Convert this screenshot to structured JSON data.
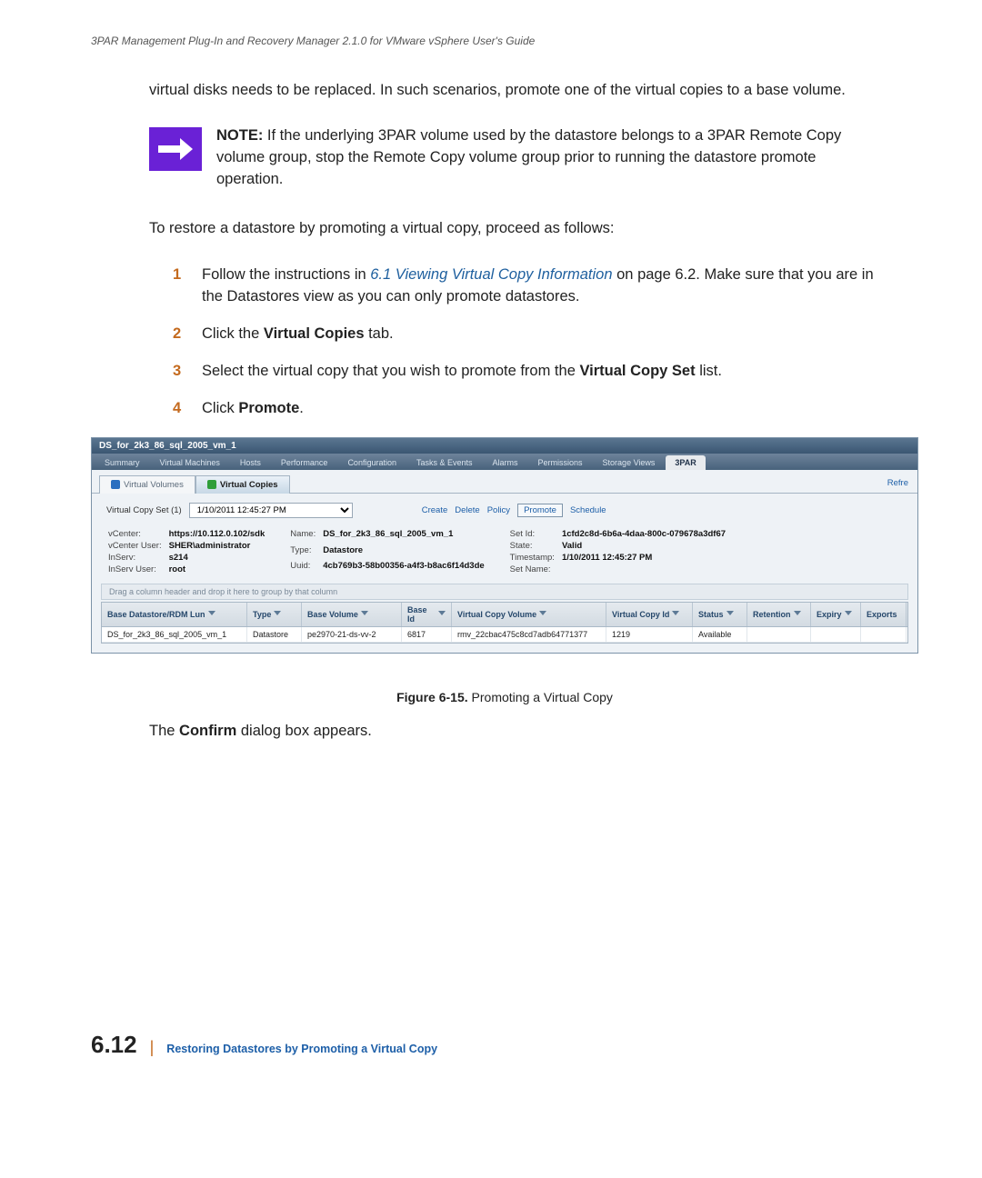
{
  "doc": {
    "header": "3PAR Management Plug-In and Recovery Manager 2.1.0 for VMware vSphere User's Guide",
    "intro": "virtual disks needs to be replaced. In such scenarios, promote one of the virtual copies to a base volume.",
    "note_label": "NOTE:",
    "note_body": " If the underlying 3PAR volume used by the datastore belongs to a 3PAR Remote Copy volume group, stop the Remote Copy volume group prior to running the datastore promote operation.",
    "lead": "To restore a datastore by promoting a virtual copy, proceed as follows:",
    "steps": {
      "s1a": "Follow the instructions in ",
      "s1link": "6.1 Viewing Virtual Copy Information",
      "s1b": " on page 6.2. Make sure that you are in the Datastores view as you can only promote datastores.",
      "s2a": "Click the ",
      "s2b": "Virtual Copies",
      "s2c": " tab.",
      "s3a": "Select the virtual copy that you wish to promote from the ",
      "s3b": "Virtual Copy Set",
      "s3c": " list.",
      "s4a": "Click ",
      "s4b": "Promote",
      "s4c": "."
    },
    "figure_label": "Figure 6-15.",
    "figure_title": "  Promoting a Virtual Copy",
    "after_a": "The ",
    "after_b": "Confirm",
    "after_c": " dialog box appears.",
    "page_num": "6.12",
    "footer_title": "Restoring Datastores by Promoting a Virtual Copy"
  },
  "app": {
    "title": "DS_for_2k3_86_sql_2005_vm_1",
    "tabs": [
      "Summary",
      "Virtual Machines",
      "Hosts",
      "Performance",
      "Configuration",
      "Tasks & Events",
      "Alarms",
      "Permissions",
      "Storage Views",
      "3PAR"
    ],
    "sub_tabs": {
      "vv": "Virtual Volumes",
      "vc": "Virtual Copies"
    },
    "refresh": "Refre",
    "vcs_label": "Virtual Copy Set (1)",
    "vcs_value": "1/10/2011 12:45:27 PM",
    "actions": {
      "create": "Create",
      "delete": "Delete",
      "policy": "Policy",
      "promote": "Promote",
      "schedule": "Schedule"
    },
    "info": {
      "vcenter_l": "vCenter:",
      "vcenter_v": "https://10.112.0.102/sdk",
      "vuser_l": "vCenter User:",
      "vuser_v": "SHER\\administrator",
      "inserv_l": "InServ:",
      "inserv_v": "s214",
      "iuser_l": "InServ User:",
      "iuser_v": "root",
      "name_l": "Name:",
      "name_v": "DS_for_2k3_86_sql_2005_vm_1",
      "type_l": "Type:",
      "type_v": "Datastore",
      "uuid_l": "Uuid:",
      "uuid_v": "4cb769b3-58b00356-a4f3-b8ac6f14d3de",
      "setid_l": "Set Id:",
      "setid_v": "1cfd2c8d-6b6a-4daa-800c-079678a3df67",
      "state_l": "State:",
      "state_v": "Valid",
      "ts_l": "Timestamp:",
      "ts_v": "1/10/2011 12:45:27 PM",
      "setname_l": "Set Name:",
      "setname_v": ""
    },
    "group_hint": "Drag a column header and drop it here to group by that column",
    "cols": {
      "bdl": "Base Datastore/RDM Lun",
      "type": "Type",
      "bv": "Base Volume",
      "bid": "Base Id",
      "vcv": "Virtual Copy Volume",
      "vcid": "Virtual Copy Id",
      "status": "Status",
      "ret": "Retention",
      "exp": "Expiry",
      "exports": "Exports"
    },
    "row": {
      "bdl": "DS_for_2k3_86_sql_2005_vm_1",
      "type": "Datastore",
      "bv": "pe2970-21-ds-vv-2",
      "bid": "6817",
      "vcv": "rmv_22cbac475c8cd7adb64771377",
      "vcid": "1219",
      "status": "Available",
      "ret": "",
      "exp": "",
      "exports": ""
    }
  }
}
